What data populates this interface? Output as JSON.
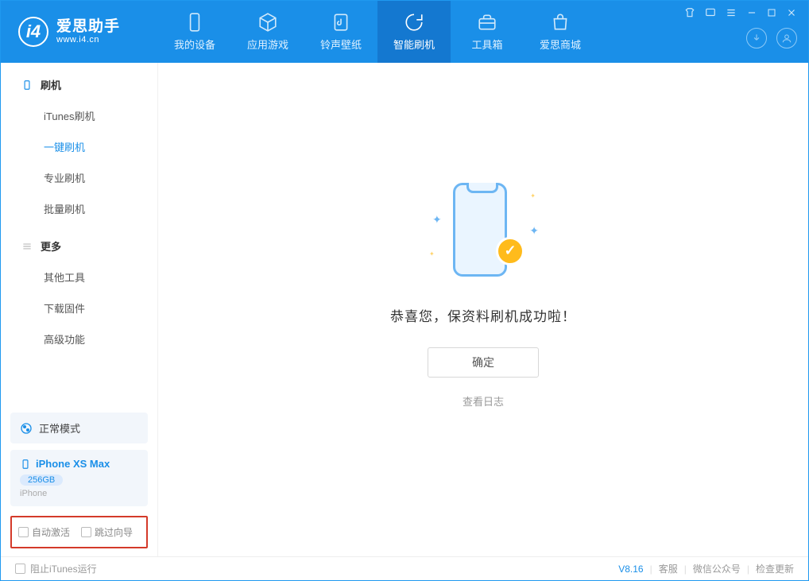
{
  "app": {
    "name_cn": "爱思助手",
    "name_en": "www.i4.cn"
  },
  "nav": {
    "device": "我的设备",
    "apps": "应用游戏",
    "ringtone": "铃声壁纸",
    "flash": "智能刷机",
    "toolbox": "工具箱",
    "store": "爱思商城"
  },
  "sidebar": {
    "section_flash": "刷机",
    "items_flash": {
      "itunes": "iTunes刷机",
      "onekey": "一键刷机",
      "pro": "专业刷机",
      "batch": "批量刷机"
    },
    "section_more": "更多",
    "items_more": {
      "other": "其他工具",
      "firmware": "下载固件",
      "advanced": "高级功能"
    },
    "status_mode": "正常模式",
    "device": {
      "name": "iPhone XS Max",
      "capacity": "256GB",
      "type": "iPhone"
    },
    "options": {
      "auto_activate": "自动激活",
      "skip_guide": "跳过向导"
    }
  },
  "main": {
    "success_text": "恭喜您，保资料刷机成功啦！",
    "confirm": "确定",
    "view_log": "查看日志"
  },
  "footer": {
    "block_itunes": "阻止iTunes运行",
    "version": "V8.16",
    "support": "客服",
    "wechat": "微信公众号",
    "update": "检查更新"
  }
}
